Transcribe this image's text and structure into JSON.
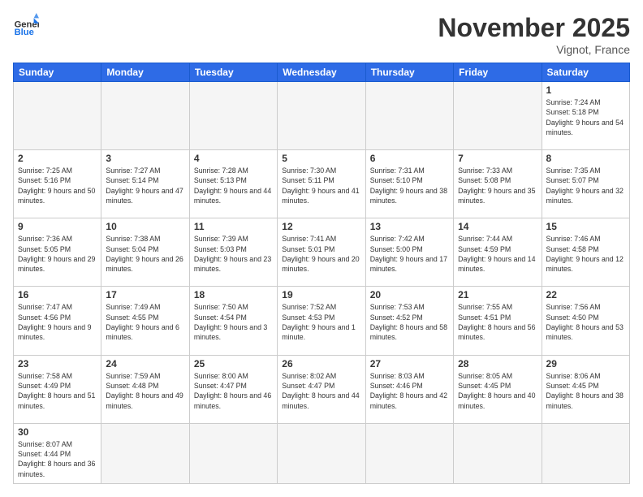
{
  "header": {
    "logo_general": "General",
    "logo_blue": "Blue",
    "month_title": "November 2025",
    "location": "Vignot, France"
  },
  "days_of_week": [
    "Sunday",
    "Monday",
    "Tuesday",
    "Wednesday",
    "Thursday",
    "Friday",
    "Saturday"
  ],
  "weeks": [
    [
      {
        "day": "",
        "info": ""
      },
      {
        "day": "",
        "info": ""
      },
      {
        "day": "",
        "info": ""
      },
      {
        "day": "",
        "info": ""
      },
      {
        "day": "",
        "info": ""
      },
      {
        "day": "",
        "info": ""
      },
      {
        "day": "1",
        "info": "Sunrise: 7:24 AM\nSunset: 5:18 PM\nDaylight: 9 hours and 54 minutes."
      }
    ],
    [
      {
        "day": "2",
        "info": "Sunrise: 7:25 AM\nSunset: 5:16 PM\nDaylight: 9 hours and 50 minutes."
      },
      {
        "day": "3",
        "info": "Sunrise: 7:27 AM\nSunset: 5:14 PM\nDaylight: 9 hours and 47 minutes."
      },
      {
        "day": "4",
        "info": "Sunrise: 7:28 AM\nSunset: 5:13 PM\nDaylight: 9 hours and 44 minutes."
      },
      {
        "day": "5",
        "info": "Sunrise: 7:30 AM\nSunset: 5:11 PM\nDaylight: 9 hours and 41 minutes."
      },
      {
        "day": "6",
        "info": "Sunrise: 7:31 AM\nSunset: 5:10 PM\nDaylight: 9 hours and 38 minutes."
      },
      {
        "day": "7",
        "info": "Sunrise: 7:33 AM\nSunset: 5:08 PM\nDaylight: 9 hours and 35 minutes."
      },
      {
        "day": "8",
        "info": "Sunrise: 7:35 AM\nSunset: 5:07 PM\nDaylight: 9 hours and 32 minutes."
      }
    ],
    [
      {
        "day": "9",
        "info": "Sunrise: 7:36 AM\nSunset: 5:05 PM\nDaylight: 9 hours and 29 minutes."
      },
      {
        "day": "10",
        "info": "Sunrise: 7:38 AM\nSunset: 5:04 PM\nDaylight: 9 hours and 26 minutes."
      },
      {
        "day": "11",
        "info": "Sunrise: 7:39 AM\nSunset: 5:03 PM\nDaylight: 9 hours and 23 minutes."
      },
      {
        "day": "12",
        "info": "Sunrise: 7:41 AM\nSunset: 5:01 PM\nDaylight: 9 hours and 20 minutes."
      },
      {
        "day": "13",
        "info": "Sunrise: 7:42 AM\nSunset: 5:00 PM\nDaylight: 9 hours and 17 minutes."
      },
      {
        "day": "14",
        "info": "Sunrise: 7:44 AM\nSunset: 4:59 PM\nDaylight: 9 hours and 14 minutes."
      },
      {
        "day": "15",
        "info": "Sunrise: 7:46 AM\nSunset: 4:58 PM\nDaylight: 9 hours and 12 minutes."
      }
    ],
    [
      {
        "day": "16",
        "info": "Sunrise: 7:47 AM\nSunset: 4:56 PM\nDaylight: 9 hours and 9 minutes."
      },
      {
        "day": "17",
        "info": "Sunrise: 7:49 AM\nSunset: 4:55 PM\nDaylight: 9 hours and 6 minutes."
      },
      {
        "day": "18",
        "info": "Sunrise: 7:50 AM\nSunset: 4:54 PM\nDaylight: 9 hours and 3 minutes."
      },
      {
        "day": "19",
        "info": "Sunrise: 7:52 AM\nSunset: 4:53 PM\nDaylight: 9 hours and 1 minute."
      },
      {
        "day": "20",
        "info": "Sunrise: 7:53 AM\nSunset: 4:52 PM\nDaylight: 8 hours and 58 minutes."
      },
      {
        "day": "21",
        "info": "Sunrise: 7:55 AM\nSunset: 4:51 PM\nDaylight: 8 hours and 56 minutes."
      },
      {
        "day": "22",
        "info": "Sunrise: 7:56 AM\nSunset: 4:50 PM\nDaylight: 8 hours and 53 minutes."
      }
    ],
    [
      {
        "day": "23",
        "info": "Sunrise: 7:58 AM\nSunset: 4:49 PM\nDaylight: 8 hours and 51 minutes."
      },
      {
        "day": "24",
        "info": "Sunrise: 7:59 AM\nSunset: 4:48 PM\nDaylight: 8 hours and 49 minutes."
      },
      {
        "day": "25",
        "info": "Sunrise: 8:00 AM\nSunset: 4:47 PM\nDaylight: 8 hours and 46 minutes."
      },
      {
        "day": "26",
        "info": "Sunrise: 8:02 AM\nSunset: 4:47 PM\nDaylight: 8 hours and 44 minutes."
      },
      {
        "day": "27",
        "info": "Sunrise: 8:03 AM\nSunset: 4:46 PM\nDaylight: 8 hours and 42 minutes."
      },
      {
        "day": "28",
        "info": "Sunrise: 8:05 AM\nSunset: 4:45 PM\nDaylight: 8 hours and 40 minutes."
      },
      {
        "day": "29",
        "info": "Sunrise: 8:06 AM\nSunset: 4:45 PM\nDaylight: 8 hours and 38 minutes."
      }
    ],
    [
      {
        "day": "30",
        "info": "Sunrise: 8:07 AM\nSunset: 4:44 PM\nDaylight: 8 hours and 36 minutes."
      },
      {
        "day": "",
        "info": ""
      },
      {
        "day": "",
        "info": ""
      },
      {
        "day": "",
        "info": ""
      },
      {
        "day": "",
        "info": ""
      },
      {
        "day": "",
        "info": ""
      },
      {
        "day": "",
        "info": ""
      }
    ]
  ]
}
